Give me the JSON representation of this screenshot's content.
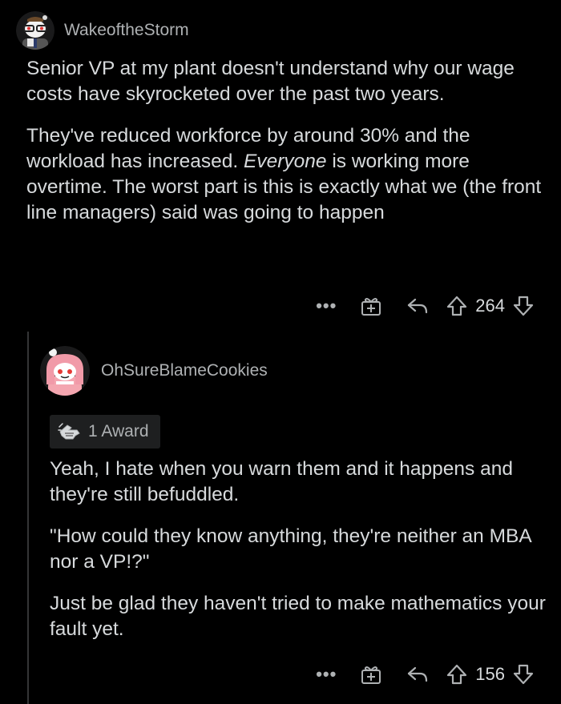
{
  "comments": [
    {
      "author": "WakeoftheStorm",
      "paragraphs": [
        "Senior VP at my plant doesn't understand why our wage costs have skyrocketed over the past two years.",
        "They've reduced workforce by around 30% and the workload has increased.",
        "Everyone",
        "is working more overtime. The worst part is this is exactly what we (the front line managers) said was going to happen"
      ],
      "more_label": "•••",
      "score": "264",
      "icons": [
        "avatar",
        "more-icon",
        "award-gift-icon",
        "reply-icon",
        "upvote-icon",
        "downvote-icon"
      ]
    },
    {
      "author": "OhSureBlameCookies",
      "award_label": "1 Award",
      "paragraphs": [
        "Yeah, I hate when you warn them and it happens and they're still befuddled.",
        "\"How could they know anything, they're neither an MBA nor a VP!?\"",
        "Just be glad they haven't tried to make mathematics your fault yet."
      ],
      "more_label": "•••",
      "score": "156",
      "icons": [
        "avatar",
        "award-icon",
        "more-icon",
        "award-gift-icon",
        "reply-icon",
        "upvote-icon",
        "downvote-icon"
      ]
    }
  ],
  "colors": {
    "background": "#000000",
    "text": "#d7dadc",
    "meta": "#aeb1b3",
    "thread_line": "#343536",
    "badge_bg": "#1e1f20"
  }
}
